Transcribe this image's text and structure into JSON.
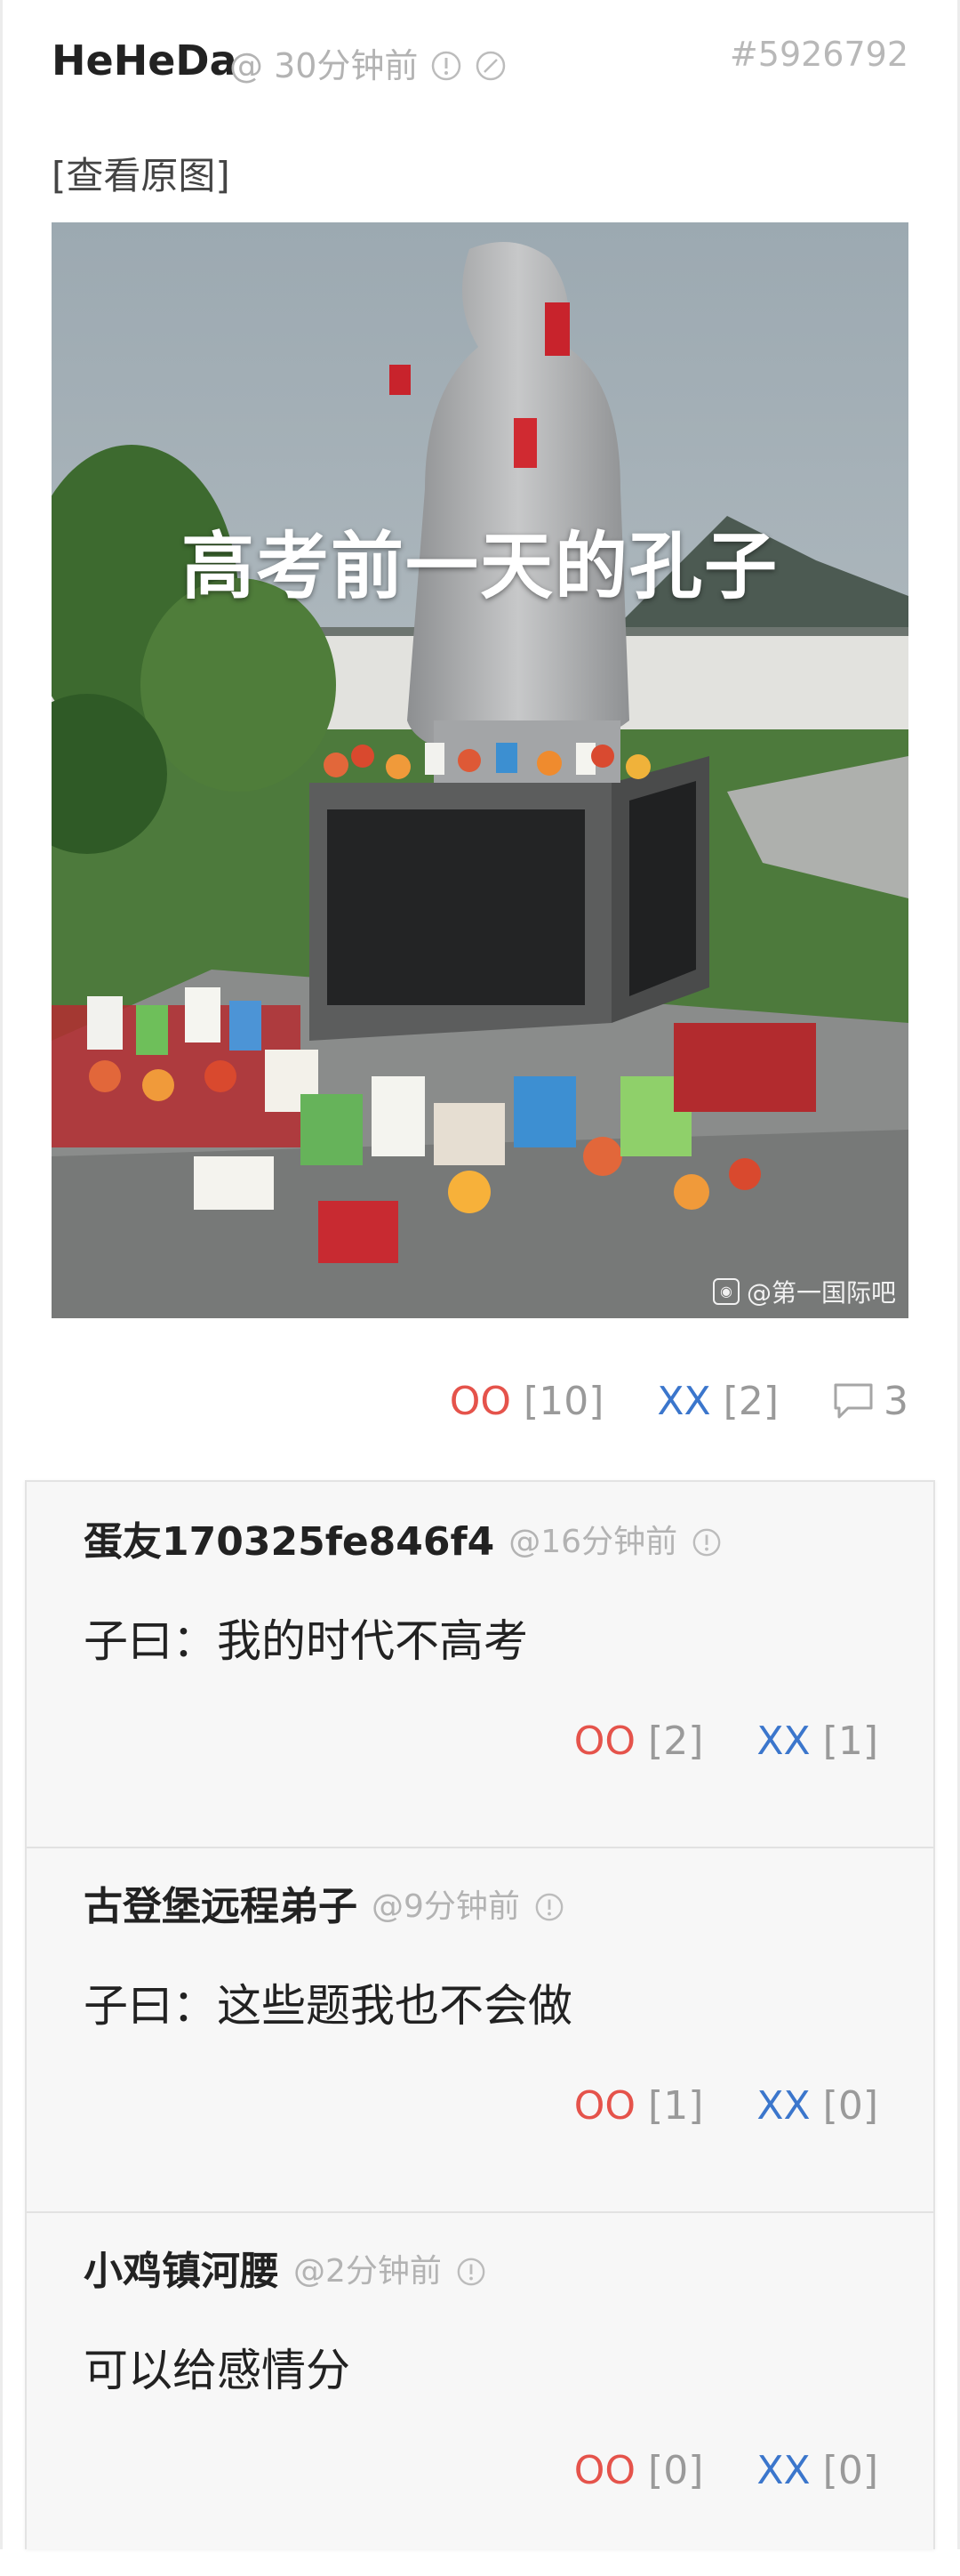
{
  "post": {
    "author": "HeHeDa",
    "meta": "@ 30分钟前",
    "id": "#5926792",
    "view_original": "[查看原图]",
    "image_caption": "高考前一天的孔子",
    "image_watermark": "@第一国际吧",
    "oo_label": "OO",
    "oo_count": "[10]",
    "xx_label": "XX",
    "xx_count": "[2]",
    "comment_count": "3"
  },
  "comments": [
    {
      "author": "蛋友170325fe846f4",
      "time": "@16分钟前",
      "text": "子曰：我的时代不高考",
      "oo_label": "OO",
      "oo_count": "[2]",
      "xx_label": "XX",
      "xx_count": "[1]"
    },
    {
      "author": "古登堡远程弟子",
      "time": "@9分钟前",
      "text": "子曰：这些题我也不会做",
      "oo_label": "OO",
      "oo_count": "[1]",
      "xx_label": "XX",
      "xx_count": "[0]"
    },
    {
      "author": "小鸡镇河腰",
      "time": "@2分钟前",
      "text": "可以给感情分",
      "oo_label": "OO",
      "oo_count": "[0]",
      "xx_label": "XX",
      "xx_count": "[0]"
    }
  ],
  "colors": {
    "oo": "#e5534b",
    "xx": "#3b76cc",
    "muted": "#b3b3b3"
  },
  "icons": {
    "report": "info-circle-icon",
    "block": "slash-circle-icon",
    "comment": "speech-bubble-icon"
  }
}
